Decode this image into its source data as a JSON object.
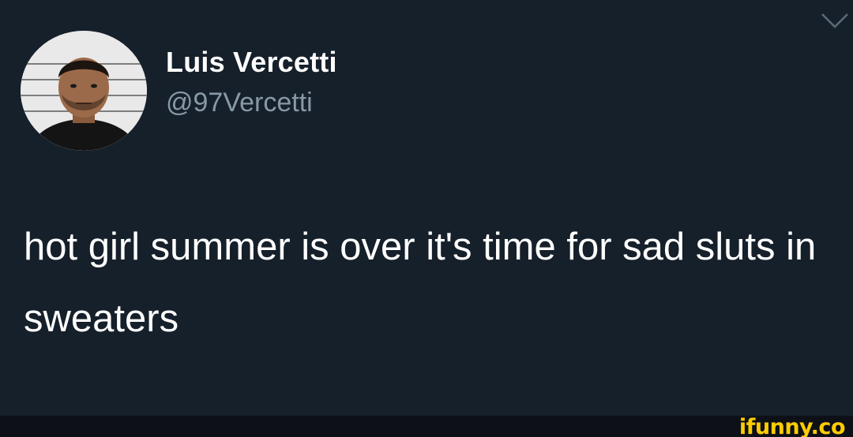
{
  "tweet": {
    "author_name": "Luis Vercetti",
    "author_handle": "@97Vercetti",
    "text": "hot girl summer is over it's time for sad sluts in sweaters",
    "menu_icon": "chevron-down-icon"
  },
  "watermark": {
    "text": "ifunny.co"
  },
  "colors": {
    "background": "#16202b",
    "name": "#ffffff",
    "handle": "#8899a6",
    "watermark": "#ffcc00"
  }
}
